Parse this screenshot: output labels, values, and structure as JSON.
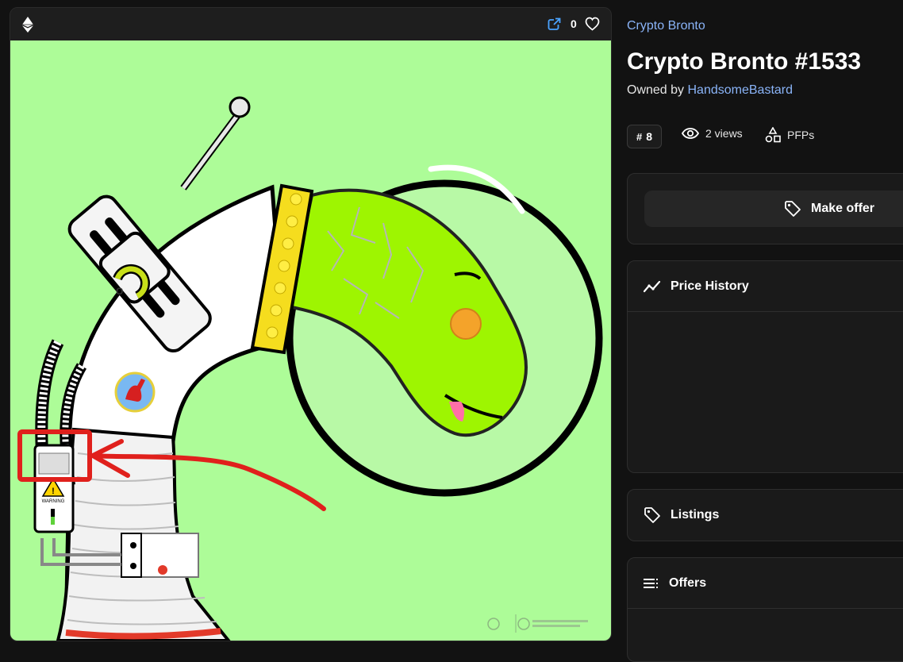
{
  "header": {
    "favorite_count": "0",
    "icons": [
      "ethereum-icon",
      "external-link-icon",
      "heart-icon"
    ]
  },
  "artwork": {
    "background_color": "#adfc98",
    "watermark_text": "WARNING"
  },
  "details": {
    "collection_name": "Crypto Bronto",
    "title": "Crypto Bronto #1533",
    "owned_by_label": "Owned by",
    "owner_name": "HandsomeBastard",
    "rank_symbol": "#",
    "rank_value": "8",
    "views_label": "2 views",
    "category_label": "PFPs"
  },
  "actions": {
    "make_offer_label": "Make offer"
  },
  "sections": {
    "price_history_label": "Price History",
    "listings_label": "Listings",
    "offers_label": "Offers"
  },
  "colors": {
    "accent_link": "#8ab4f8",
    "page_bg": "#121212",
    "panel_bg": "#1a1a1a",
    "annotation_red": "#e0201c"
  }
}
